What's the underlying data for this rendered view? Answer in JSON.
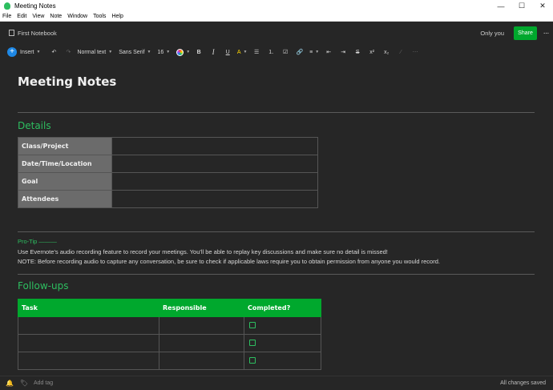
{
  "window": {
    "title": "Meeting Notes",
    "controls": [
      "—",
      "☐",
      "✕"
    ]
  },
  "menu": [
    "File",
    "Edit",
    "View",
    "Note",
    "Window",
    "Tools",
    "Help"
  ],
  "header": {
    "notebook": "First Notebook",
    "sharing": "Only you",
    "share_label": "Share",
    "more": "···"
  },
  "toolbar": {
    "insert_label": "Insert",
    "insert_icon": "+",
    "undo": "↶",
    "redo": "↷",
    "style": "Normal text",
    "font": "Sans Serif",
    "size": "16",
    "bold": "B",
    "italic": "I",
    "underline": "U",
    "highlight": "A",
    "bulleted": "☰",
    "numbered": "⒈",
    "checklist": "☑",
    "link": "🔗",
    "align": "≡",
    "outdent": "⇤",
    "indent": "⇥",
    "strike": "S",
    "superscript": "x²",
    "subscript": "x₂",
    "format_clear": "⁄",
    "more_format": "⋯"
  },
  "note": {
    "title": "Meeting Notes",
    "details_heading": "Details",
    "details_rows": [
      {
        "label": "Class/Project",
        "value": ""
      },
      {
        "label": "Date/Time/Location",
        "value": ""
      },
      {
        "label": "Goal",
        "value": ""
      },
      {
        "label": "Attendees",
        "value": ""
      }
    ],
    "protip": {
      "heading": "Pro-Tip ———",
      "line1": "Use Evernote's audio recording feature to record your meetings. You'll be able to replay key discussions and make sure no detail is missed!",
      "line2": "NOTE: Before recording audio to capture any conversation, be sure to check if applicable laws require you to obtain permission from anyone you would record."
    },
    "followups_heading": "Follow-ups",
    "followups_columns": [
      "Task",
      "Responsible",
      "Completed?"
    ]
  },
  "footer": {
    "add_tag": "Add tag",
    "status": "All changes saved"
  },
  "colors": {
    "accent": "#00a82d",
    "heading_green": "#2dbe60",
    "background": "#262626"
  }
}
